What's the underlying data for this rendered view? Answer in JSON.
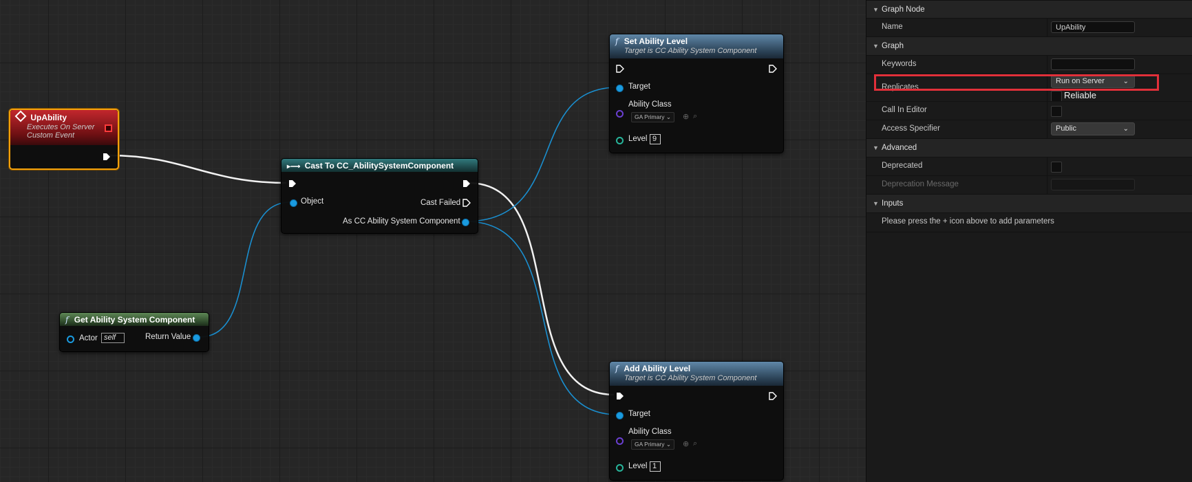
{
  "graph": {
    "event_node": {
      "title": "UpAbility",
      "subtitle1": "Executes On Server",
      "subtitle2": "Custom Event"
    },
    "cast_node": {
      "title": "Cast To CC_AbilitySystemComponent",
      "object_pin": "Object",
      "cast_failed_pin": "Cast Failed",
      "as_pin": "As CC Ability System Component"
    },
    "get_asc_node": {
      "title": "Get Ability System Component",
      "actor_pin": "Actor",
      "actor_value": "self",
      "return_pin": "Return Value"
    },
    "set_level_node": {
      "title": "Set Ability Level",
      "subtitle": "Target is CC Ability System Component",
      "target_pin": "Target",
      "ability_class_pin": "Ability Class",
      "ability_class_value": "GA Primary",
      "level_pin": "Level",
      "level_value": "9"
    },
    "add_level_node": {
      "title": "Add Ability Level",
      "subtitle": "Target is CC Ability System Component",
      "target_pin": "Target",
      "ability_class_pin": "Ability Class",
      "ability_class_value": "GA Primary",
      "level_pin": "Level",
      "level_value": "1"
    },
    "icon_function": "function-icon",
    "icon_event": "event-icon",
    "icon_cast": "cast-icon"
  },
  "details": {
    "sections": {
      "graph_node": "Graph Node",
      "graph": "Graph",
      "advanced": "Advanced",
      "inputs": "Inputs"
    },
    "rows": {
      "name_label": "Name",
      "name_value": "UpAbility",
      "keywords_label": "Keywords",
      "keywords_value": "",
      "replicates_label": "Replicates",
      "replicates_value": "Run on Server",
      "reliable_label": "Reliable",
      "call_in_editor_label": "Call In Editor",
      "access_label": "Access Specifier",
      "access_value": "Public",
      "deprecated_label": "Deprecated",
      "deprecation_msg_label": "Deprecation Message",
      "inputs_hint": "Please press the + icon above to add parameters"
    }
  },
  "colors": {
    "highlight": "#e2303a",
    "selection": "#f3a10c",
    "object_pin": "#1a9be0",
    "exec_wire": "#ffffff"
  }
}
